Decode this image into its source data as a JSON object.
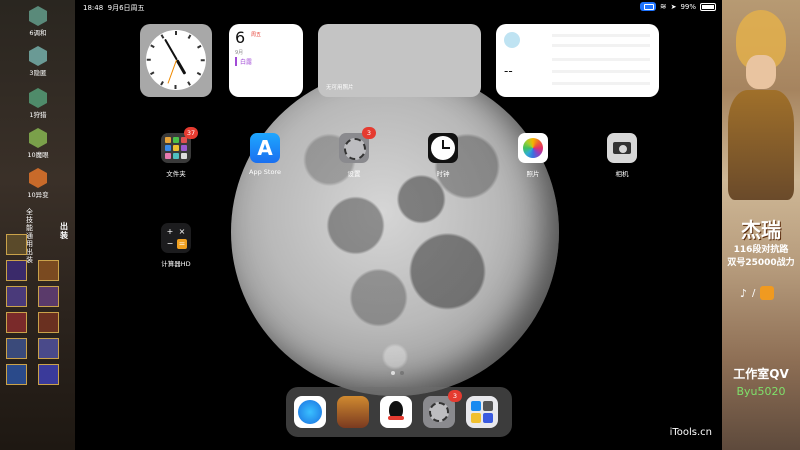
{
  "status_bar": {
    "time": "18:48",
    "date": "9月6日周五",
    "battery": "99%"
  },
  "widgets": {
    "calendar": {
      "day": "6",
      "weekday": "周五",
      "month_label": "9月",
      "event": "白露"
    },
    "photos": {
      "empty_label": "无可用照片"
    },
    "batteries": {
      "value": "--"
    }
  },
  "apps": [
    {
      "label": "文件夹",
      "badge": "37"
    },
    {
      "label": "App Store",
      "badge": ""
    },
    {
      "label": "设置",
      "badge": "3"
    },
    {
      "label": "时钟",
      "badge": ""
    },
    {
      "label": "照片",
      "badge": ""
    },
    {
      "label": "相机",
      "badge": ""
    },
    {
      "label": "计算器HD",
      "badge": ""
    }
  ],
  "dock": {
    "settings_badge": "3"
  },
  "left_panel": {
    "ranks": [
      "6调和",
      "3隐匿",
      "1狩猎",
      "10魔眼",
      "10异变"
    ],
    "equip_label": "全技能通用出装",
    "equip_side": "出装"
  },
  "right_panel": {
    "hero_name": "杰瑞",
    "line1": "116段对抗路",
    "line2": "双号25000战力",
    "studio": "工作室QV",
    "contact": "Byu5020",
    "platform_sep": "/"
  },
  "watermark": "iTools.cn"
}
